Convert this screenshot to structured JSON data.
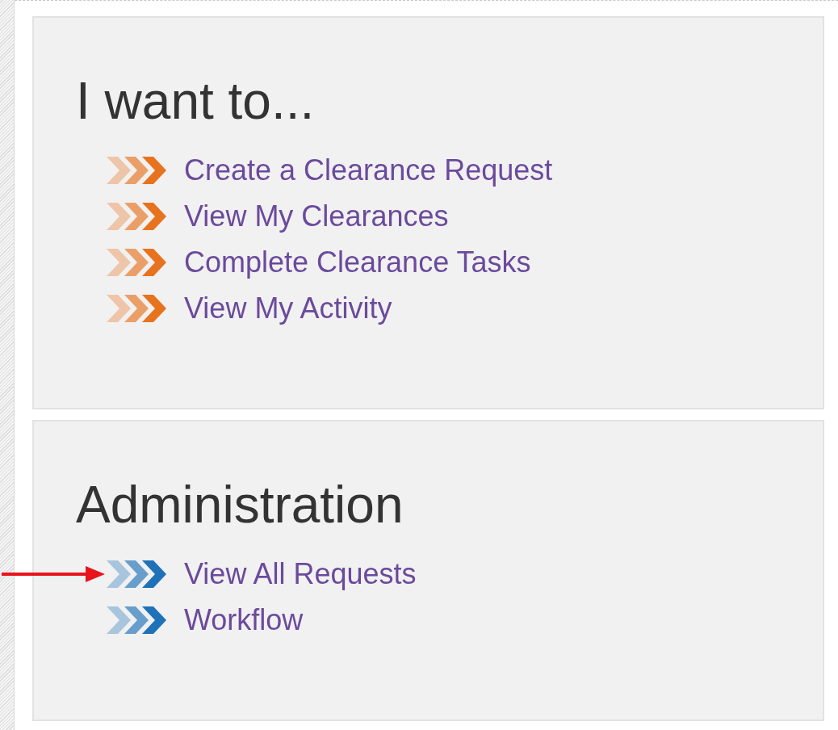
{
  "sections": [
    {
      "title": "I want to...",
      "color": "#e8731f",
      "links": [
        {
          "label": "Create a Clearance Request",
          "marked": false
        },
        {
          "label": "View My Clearances",
          "marked": false
        },
        {
          "label": "Complete Clearance Tasks",
          "marked": false
        },
        {
          "label": "View My Activity",
          "marked": false
        }
      ]
    },
    {
      "title": "Administration",
      "color": "#1f72b8",
      "links": [
        {
          "label": "View All Requests",
          "marked": true
        },
        {
          "label": "Workflow",
          "marked": false
        }
      ]
    }
  ]
}
